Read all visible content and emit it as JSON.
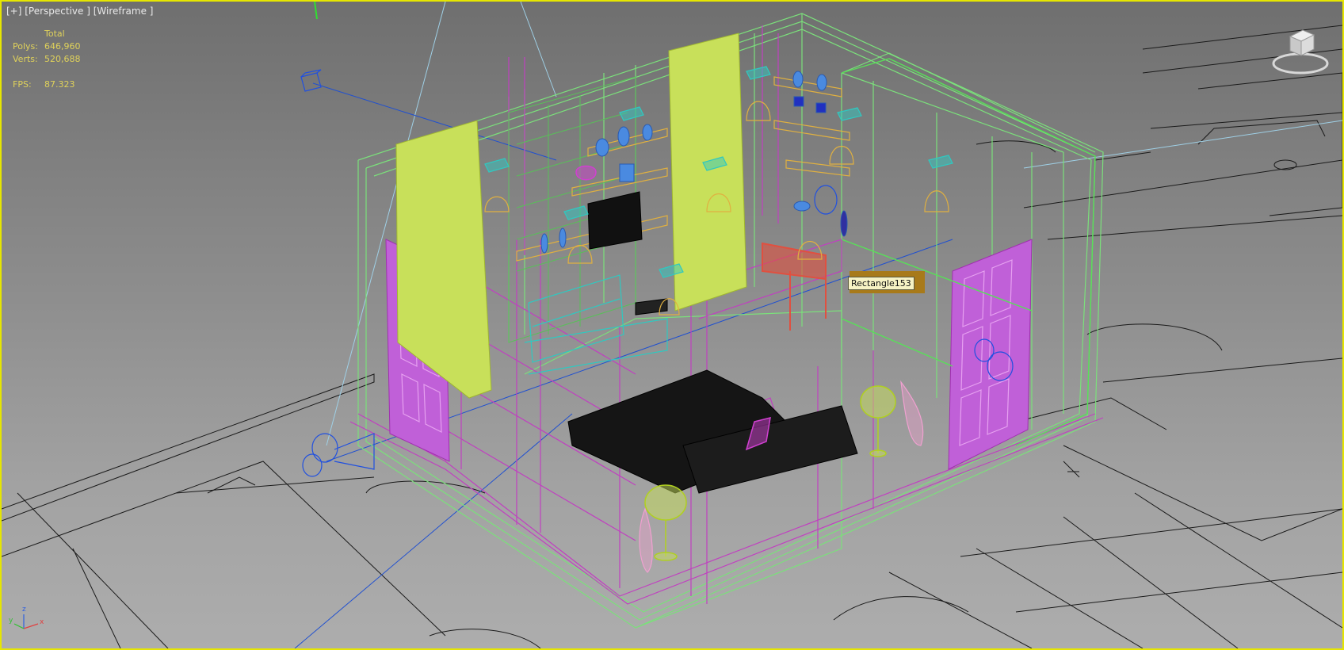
{
  "viewport": {
    "label": "[+] [Perspective ] [Wireframe ]",
    "border_color": "#e6e600",
    "shading": "Wireframe",
    "view": "Perspective"
  },
  "stats": {
    "header": "Total",
    "polys_label": "Polys:",
    "polys_value": "646,960",
    "verts_label": "Verts:",
    "verts_value": "520,688",
    "fps_label": "FPS:",
    "fps_value": "87.323",
    "color": "#e0d25a"
  },
  "tooltip": {
    "text": "Rectangle153"
  },
  "viewcube": {
    "icon": "viewcube-icon"
  },
  "axis_tripod": {
    "z": "z",
    "y": "y",
    "x": "x"
  },
  "colors": {
    "wire_green": "#7be07b",
    "wire_magenta": "#c040c0",
    "wire_yellow": "#c8e05a",
    "wire_blue": "#3060e0",
    "wire_cyan": "#30c8c0",
    "wire_orange": "#e0a040",
    "wire_black": "#111111",
    "floorplan": "#1a1a1a"
  }
}
